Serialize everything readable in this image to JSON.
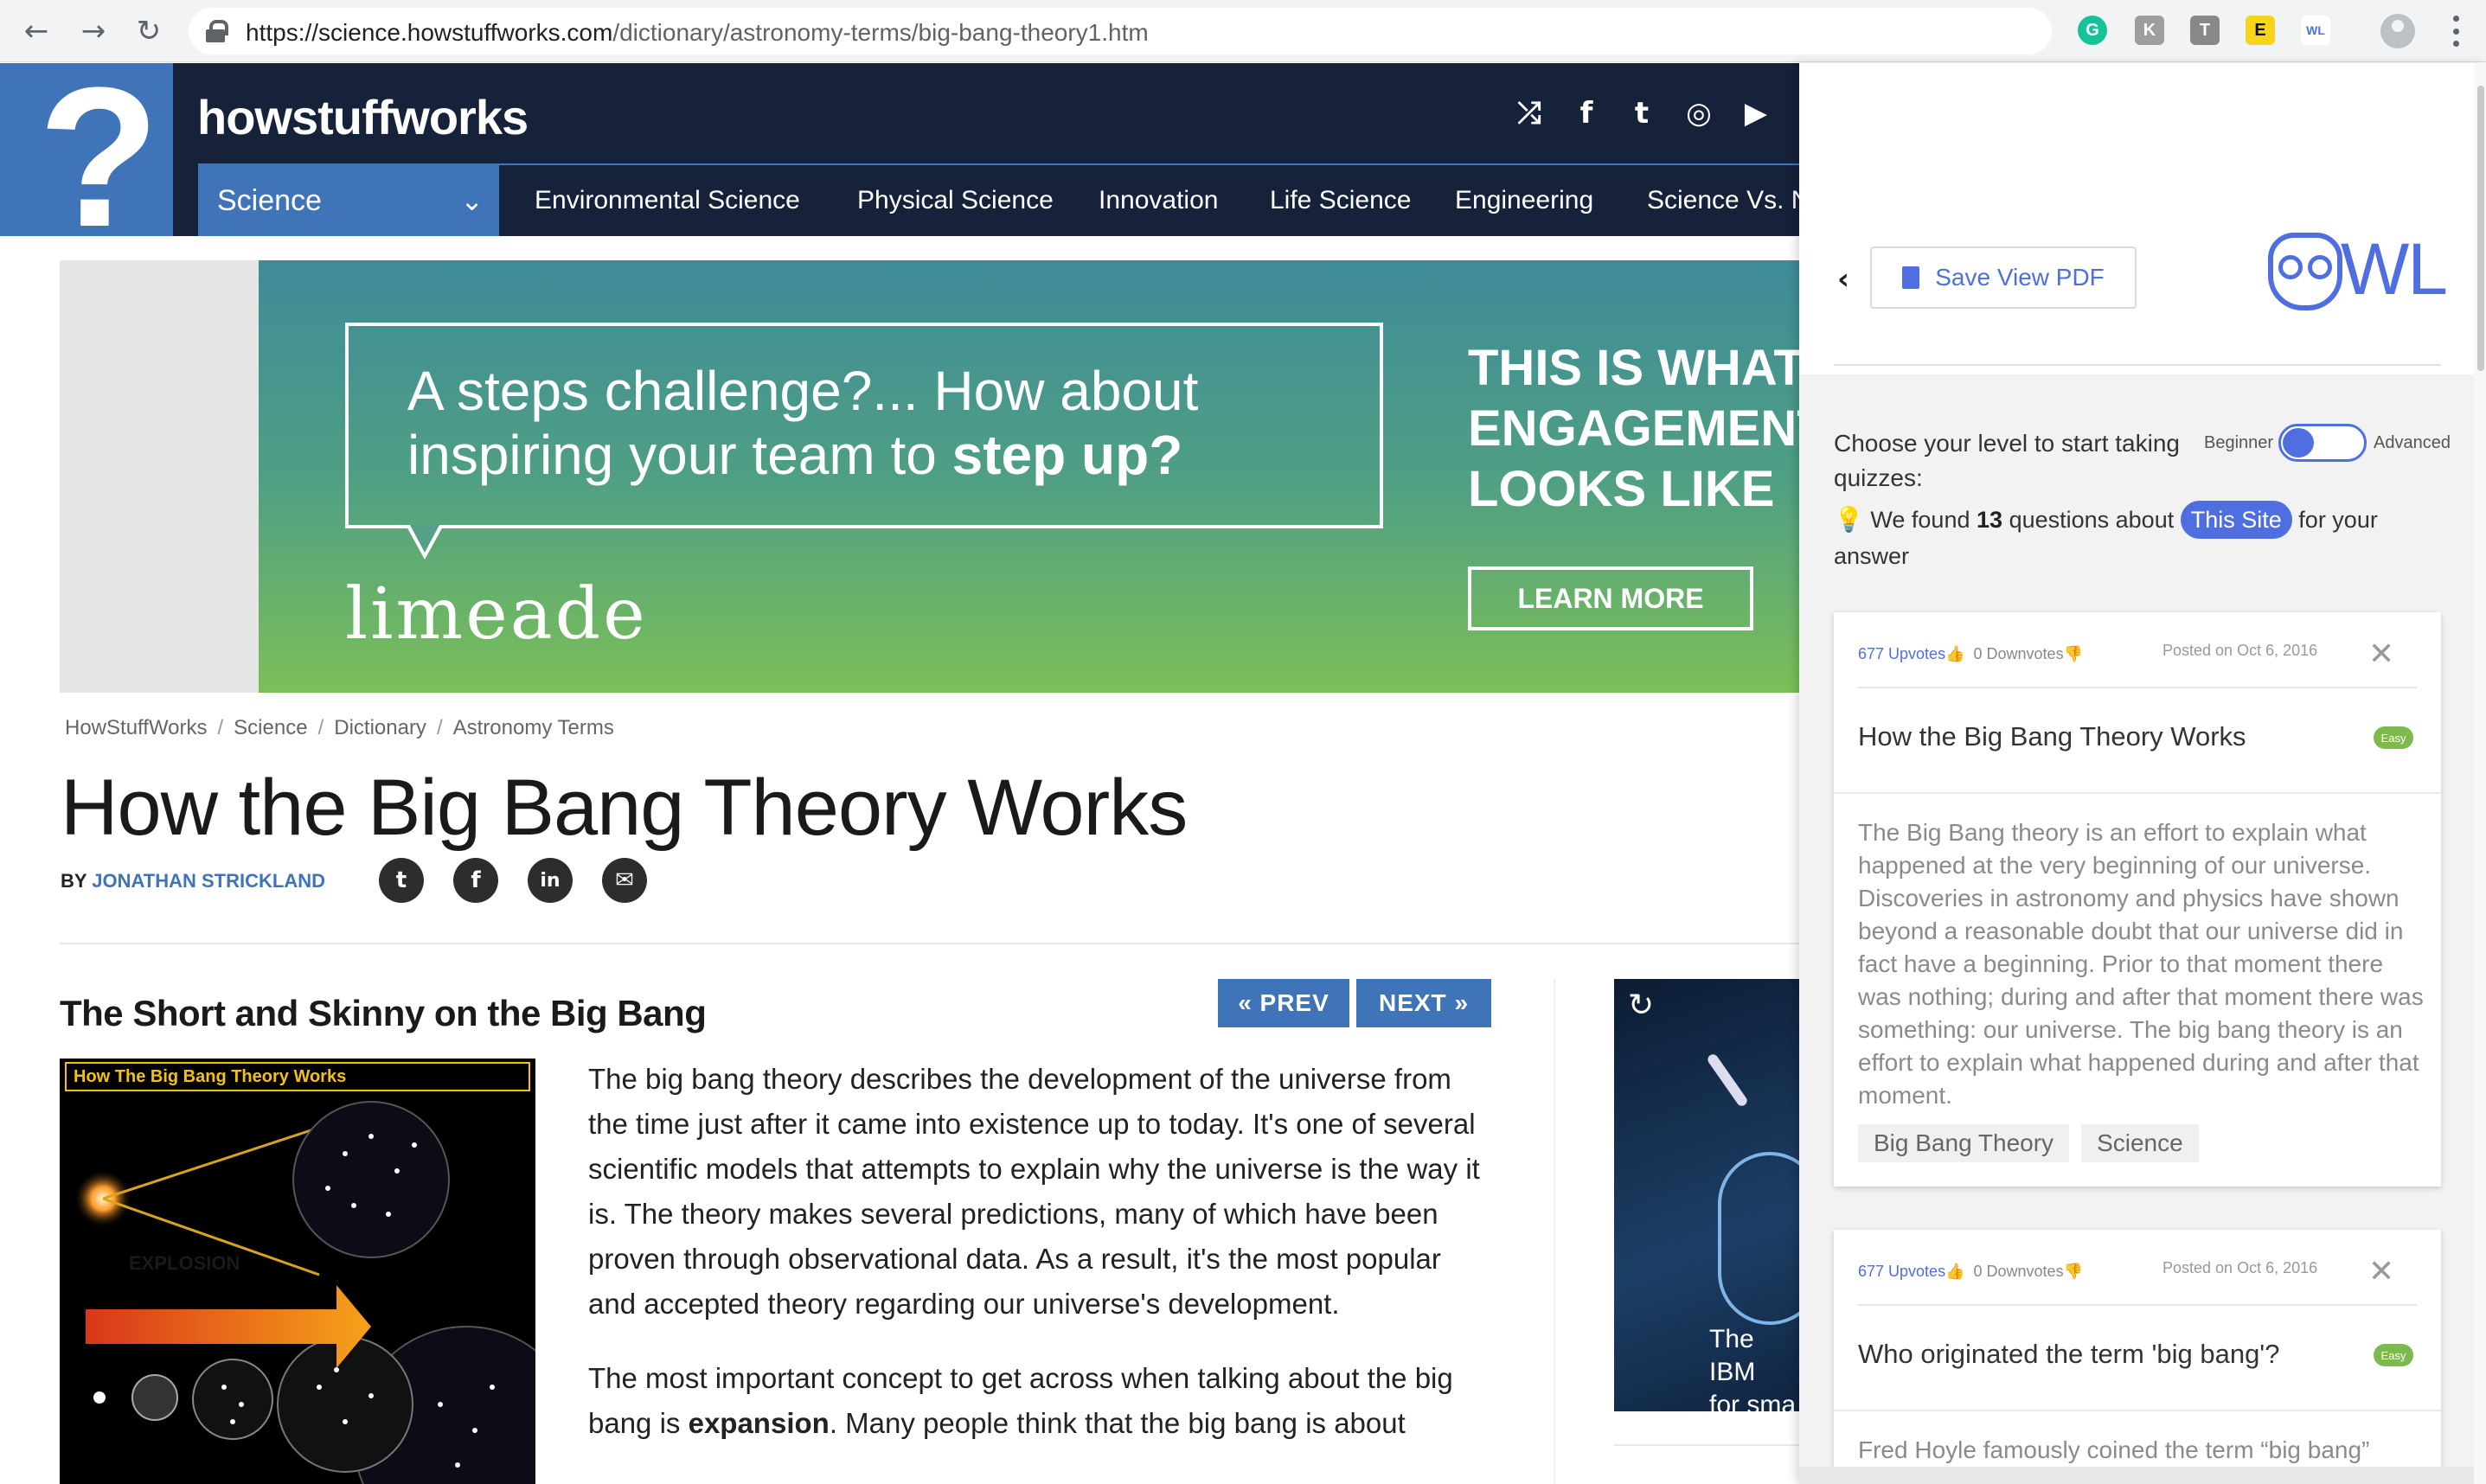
{
  "browser": {
    "url_host": "https://science.howstuffworks.com",
    "url_path": "/dictionary/astronomy-terms/big-bang-theory1.htm",
    "back_glyph": "←",
    "forward_glyph": "→",
    "reload_glyph": "↻",
    "star_glyph": "☆",
    "extensions": [
      {
        "name": "grammarly-icon",
        "glyph": "G",
        "color": "#15c39a"
      },
      {
        "name": "extension-k-icon",
        "glyph": "K",
        "color": "#9e9e9e"
      },
      {
        "name": "extension-t-icon",
        "glyph": "T",
        "color": "#888888"
      },
      {
        "name": "extension-e-icon",
        "glyph": "E",
        "color": "#111111"
      },
      {
        "name": "owl-extension-icon",
        "glyph": "WL",
        "color": "#4f6fe0"
      }
    ]
  },
  "site": {
    "brand": "howstuffworks",
    "logo_glyph": "?",
    "social": {
      "random": "⤮",
      "facebook": "f",
      "twitter": "t",
      "instagram": "◎",
      "youtube": "▶"
    },
    "topic_select": "Science",
    "chevron": "⌄",
    "nav": [
      "Environmental Science",
      "Physical Science",
      "Innovation",
      "Life Science",
      "Engineering",
      "Science Vs. N"
    ]
  },
  "ad": {
    "bubble_text_plain": "A steps challenge?... How about inspiring your team to ",
    "bubble_text_bold": "step up?",
    "logo": "limeade",
    "headline": "THIS IS WHAT\nENGAGEMENT\nLOOKS LIKE",
    "cta": "LEARN MORE"
  },
  "breadcrumb": [
    "HowStuffWorks",
    "Science",
    "Dictionary",
    "Astronomy Terms"
  ],
  "breadcrumb_sep": "/",
  "article": {
    "title": "How the Big Bang Theory Works",
    "by": "BY",
    "author": "JONATHAN STRICKLAND",
    "share": {
      "twitter": "t",
      "facebook": "f",
      "linkedin": "in",
      "email": "✉"
    },
    "section_title": "The Short and Skinny on the Big Bang",
    "prev": "« PREV",
    "next": "NEXT »",
    "image_caption": "How The Big Bang Theory Works",
    "image_label": "EXPLOSION",
    "paragraph1": "The big bang theory describes the development of the universe from the time just after it came into existence up to today. It's one of several scientific models that attempts to explain why the universe is the way it is. The theory makes several predictions, many of which have been proven through observational data. As a result, it's the most popular and accepted theory regarding our universe's development.",
    "paragraph2_start": "The most important concept to get across when talking about the big bang is ",
    "paragraph2_bold": "expansion",
    "paragraph2_end": ". Many people think that the big bang is about"
  },
  "video_ad": {
    "reload": "↻",
    "caption": "The IBM\nfor sma"
  },
  "owl": {
    "back": "‹",
    "save_pdf": "Save View PDF",
    "logo_text": "WL",
    "level_prompt": "Choose your level to start taking quizzes:",
    "beginner": "Beginner",
    "advanced": "Advanced",
    "bulb": "💡",
    "found_prefix": "We found",
    "found_count": "13",
    "found_mid": "questions about",
    "found_chip": "This Site",
    "found_suffix": "for your answer",
    "cards": [
      {
        "upvotes": "677 Upvotes",
        "downvotes": "0 Downvotes",
        "posted": "Posted on Oct 6, 2016",
        "close": "✕",
        "title": "How the Big Bang Theory Works",
        "difficulty": "Easy",
        "answer": "The Big Bang theory is an effort to explain what happened at the very beginning of our universe. Discoveries in astronomy and physics have shown beyond a reasonable doubt that our universe did in fact have a beginning. Prior to that moment there was nothing; during and after that moment there was something: our universe. The big bang theory is an effort to explain what happened during and after that moment.",
        "tags": [
          "Big Bang Theory",
          "Science"
        ]
      },
      {
        "upvotes": "677 Upvotes",
        "downvotes": "0 Downvotes",
        "posted": "Posted on Oct 6, 2016",
        "close": "✕",
        "title": "Who originated the term 'big bang'?",
        "difficulty": "Easy",
        "answer": "Fred Hoyle famously coined the term “big bang”"
      }
    ]
  }
}
